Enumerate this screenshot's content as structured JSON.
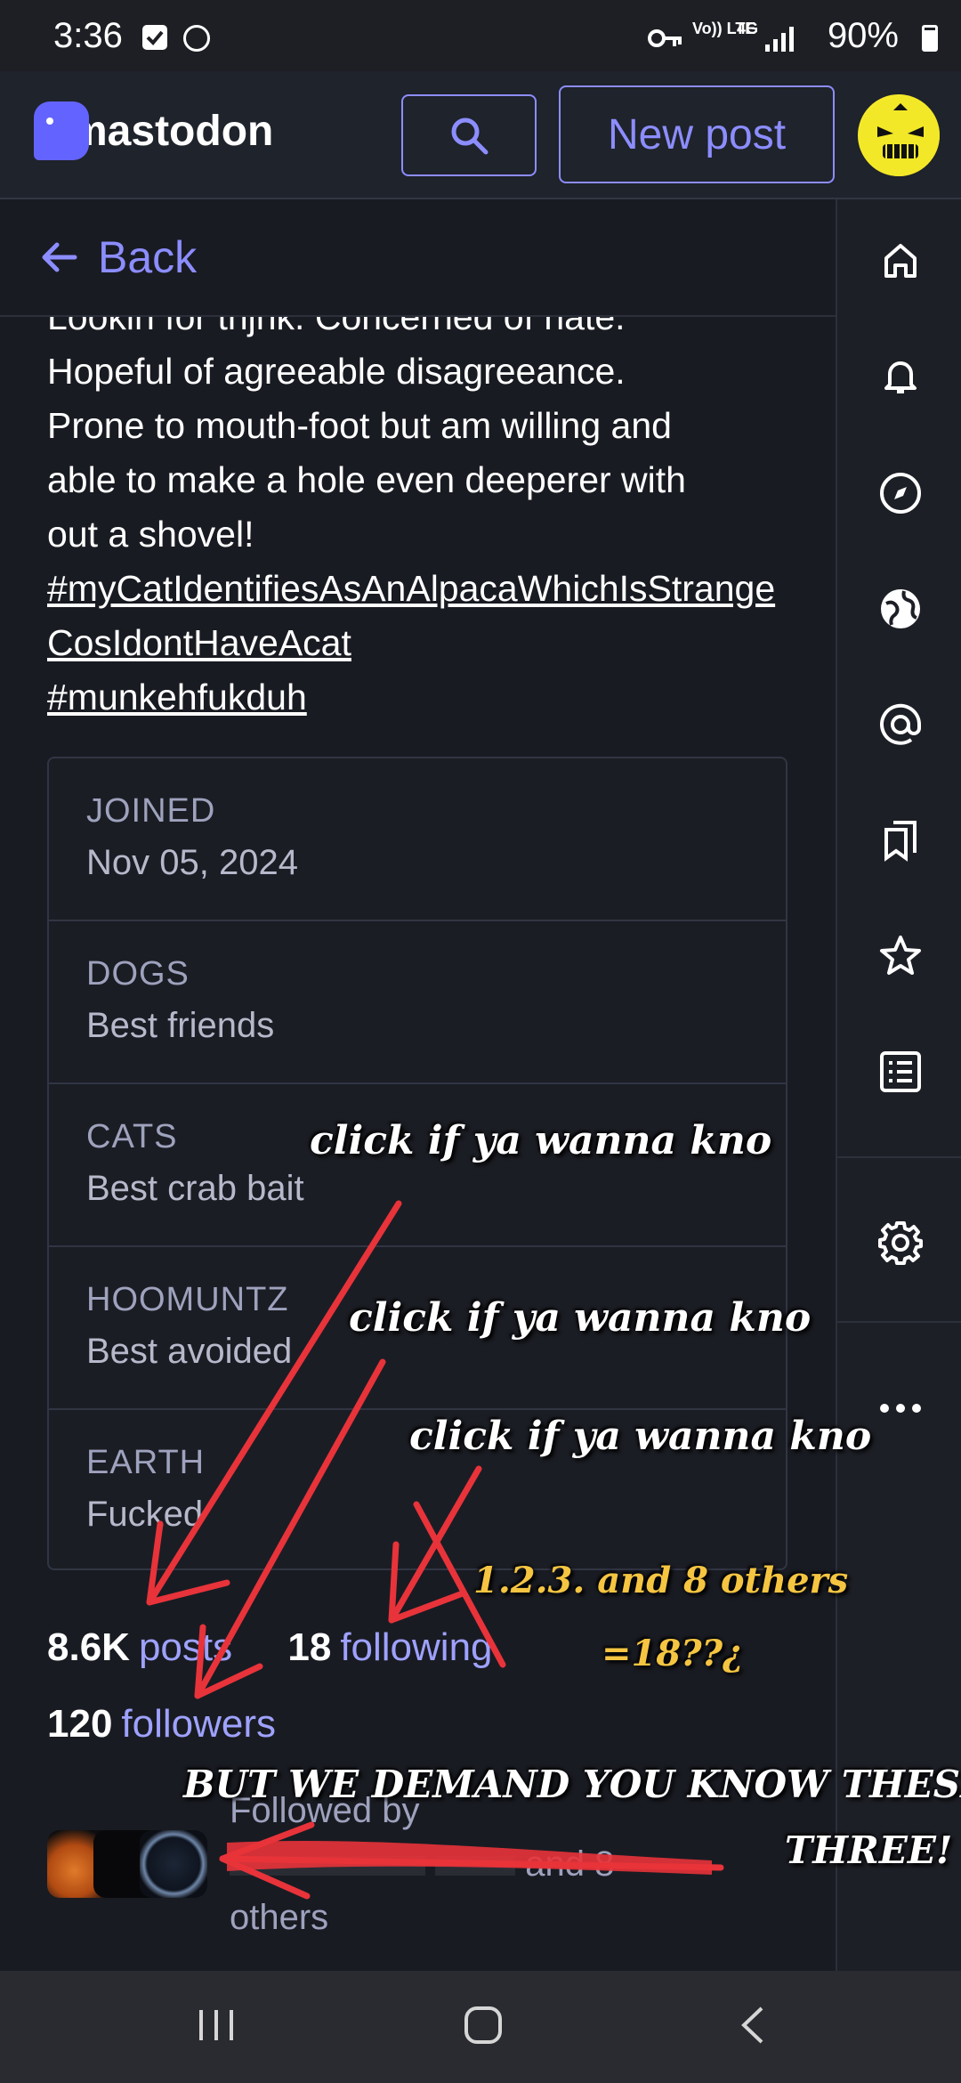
{
  "status_bar": {
    "time": "3:36",
    "battery": "90%",
    "network_small_1": "Vo)) LTE",
    "network_small_2": "4G"
  },
  "header": {
    "brand": "mastodon",
    "new_post_label": "New post",
    "search_icon": "search-icon"
  },
  "back": {
    "label": "Back"
  },
  "bio": {
    "lines": [
      "Lookin for thjnk. Concerned of hate.",
      "Hopeful of agreeable disagreeance.",
      "Prone to mouth-foot but am willing and",
      "able to make a hole even deeperer with",
      "out a shovel!"
    ],
    "hashtag_1": "#myCatIdentifiesAsAnAlpacaWhichIsStrangeCosIdontHaveAcat",
    "hashtag_2": "#munkehfukduh"
  },
  "fields": [
    {
      "name": "JOINED",
      "value": "Nov 05, 2024"
    },
    {
      "name": "DOGS",
      "value": "Best friends"
    },
    {
      "name": "CATS",
      "value": "Best crab bait"
    },
    {
      "name": "HOOMUNTZ",
      "value": "Best avoided"
    },
    {
      "name": "EARTH",
      "value": "Fucked"
    }
  ],
  "stats": {
    "posts_count": "8.6K",
    "posts_label": "posts",
    "following_count": "18",
    "following_label": "following",
    "followers_count": "120",
    "followers_label": "followers"
  },
  "followed_by": {
    "title": "Followed by",
    "suffix": "and 8",
    "others": "others"
  },
  "annotations": {
    "a1": "click if ya wanna kno",
    "a2": "click if ya wanna kno",
    "a3": "click if ya wanna kno",
    "a4": "1.2.3. and 8 others",
    "a5": "=18??¿",
    "a6": "BUT WE DEMAND YOU KNOW THESE",
    "a7": "THREE!"
  },
  "colors": {
    "accent": "#8c8dff",
    "brand": "#6364ff",
    "background": "#191b22",
    "annotation_red": "#e8333a",
    "annotation_yellow": "#f5c542"
  },
  "rail_icons": [
    "home-icon",
    "bell-icon",
    "compass-icon",
    "globe-icon",
    "at-icon",
    "bookmarks-icon",
    "star-icon",
    "list-icon",
    "gear-icon",
    "more-icon"
  ],
  "nav_icons": [
    "recents-icon",
    "home-button-icon",
    "back-nav-icon"
  ]
}
